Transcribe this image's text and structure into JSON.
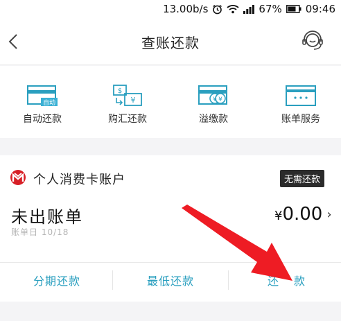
{
  "status_bar": {
    "speed": "13.00b/s",
    "battery": "67%",
    "time": "09:46"
  },
  "nav": {
    "title": "查账还款"
  },
  "features": [
    {
      "label": "自动还款",
      "icon": "auto-repay-card-icon",
      "icon_text": "自动"
    },
    {
      "label": "购汇还款",
      "icon": "currency-exchange-icon"
    },
    {
      "label": "溢缴款",
      "icon": "overpayment-icon"
    },
    {
      "label": "账单服务",
      "icon": "bill-service-card-icon"
    }
  ],
  "account": {
    "name": "个人消费卡账户",
    "badge": "无需还款",
    "bill_title": "未出账单",
    "bill_date": "账单日 10/18",
    "currency": "¥",
    "amount": "0.00"
  },
  "actions": [
    {
      "label": "分期还款"
    },
    {
      "label": "最低还款"
    },
    {
      "label": "还款"
    }
  ],
  "colors": {
    "accent": "#2a9fbf",
    "brand_red": "#d71f26",
    "arrow": "#ee1c24",
    "badge_bg": "#2b2b2b"
  }
}
